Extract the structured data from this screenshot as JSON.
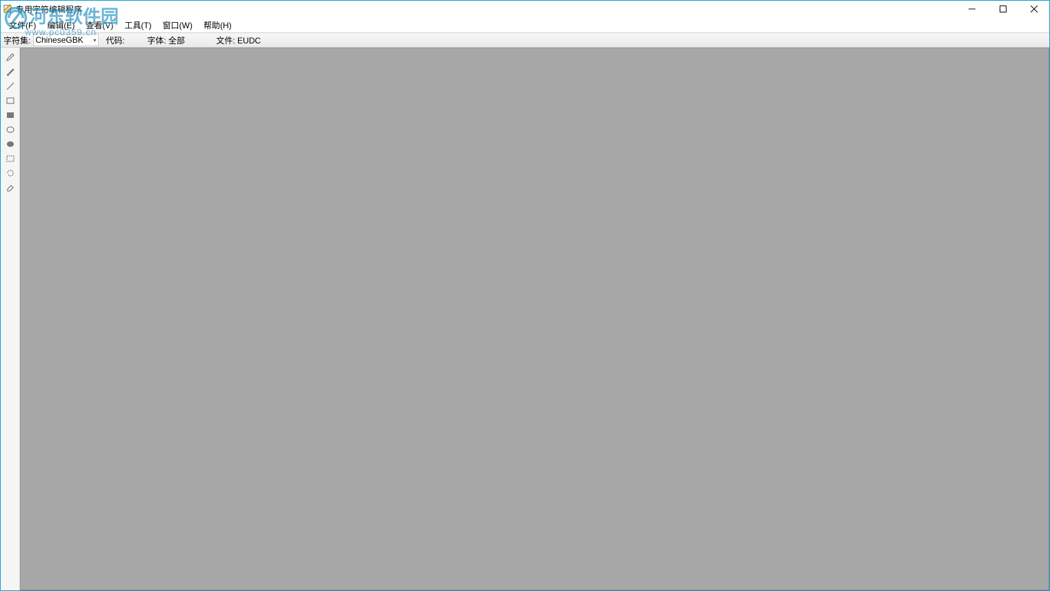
{
  "window": {
    "title": "专用字符编辑程序"
  },
  "menubar": {
    "items": [
      {
        "label": "文件(F)"
      },
      {
        "label": "编辑(E)"
      },
      {
        "label": "查看(V)"
      },
      {
        "label": "工具(T)"
      },
      {
        "label": "窗口(W)"
      },
      {
        "label": "帮助(H)"
      }
    ]
  },
  "infobar": {
    "charset_label": "字符集:",
    "charset_value": "ChineseGBK",
    "code_label": "代码:",
    "code_value": "",
    "font_label": "字体:",
    "font_value": "全部",
    "file_label": "文件:",
    "file_value": "EUDC"
  },
  "toolbox": {
    "tools": [
      {
        "name": "pencil-icon"
      },
      {
        "name": "brush-icon"
      },
      {
        "name": "line-icon"
      },
      {
        "name": "rectangle-outline-icon"
      },
      {
        "name": "rectangle-filled-icon"
      },
      {
        "name": "ellipse-outline-icon"
      },
      {
        "name": "ellipse-filled-icon"
      },
      {
        "name": "rect-select-icon"
      },
      {
        "name": "free-select-icon"
      },
      {
        "name": "eraser-icon"
      }
    ]
  },
  "watermark": {
    "text": "河东软件园",
    "url": "www.pc0359.cn"
  }
}
